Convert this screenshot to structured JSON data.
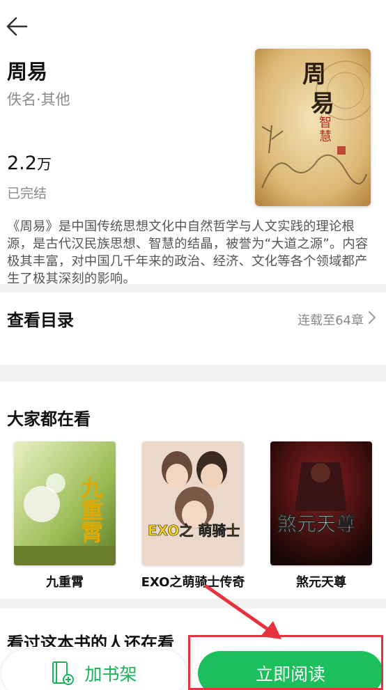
{
  "header": {
    "back_icon": "arrow-left-icon"
  },
  "book": {
    "title": "周易",
    "author_category": "佚名·其他",
    "word_count": "2.2",
    "word_unit": "万",
    "status": "已完结",
    "description": "《周易》是中国传统思想文化中自然哲学与人文实践的理论根源，是古代汉民族思想、智慧的结晶，被誉为“大道之源”。内容极其丰富，对中国几千年来的政治、经济、文化等各个领域都产生了极其深刻的影响。",
    "cover_text": {
      "line1": "周",
      "line2": "易",
      "line3": "智",
      "line4": "慧"
    }
  },
  "catalog": {
    "title": "查看目录",
    "status": "连载至64章"
  },
  "popular": {
    "title": "大家都在看",
    "books": [
      {
        "name": "九重霄",
        "cover_text": "九重霄"
      },
      {
        "name": "EXO之萌骑士传奇",
        "cover_text": "EXO之 萌骑士 传奇"
      },
      {
        "name": "煞元天尊",
        "cover_text": "煞元天尊"
      }
    ]
  },
  "next_section": {
    "title": "看过这本书的人还在看"
  },
  "bottom_bar": {
    "shelf_label": "加书架",
    "read_label": "立即阅读"
  },
  "colors": {
    "accent": "#1bbf5c",
    "annotation": "#e8333f"
  }
}
